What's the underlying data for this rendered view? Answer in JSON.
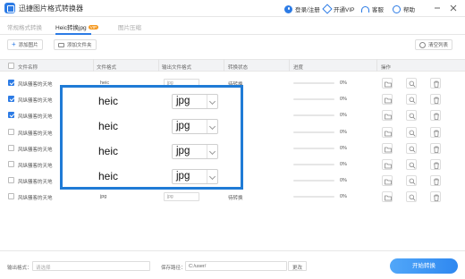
{
  "app": {
    "title": "迅捷图片格式转换器",
    "top_links": {
      "login": "登录/注册",
      "vip": "开通VIP",
      "service": "客服",
      "help": "帮助"
    }
  },
  "tabs": [
    {
      "label": "常规格式转换",
      "active": false
    },
    {
      "label": "Heic转换jpg",
      "badge": "VIP",
      "active": true
    },
    {
      "label": "图片压缩",
      "active": false
    }
  ],
  "toolbar": {
    "add_image": "添加图片",
    "add_folder": "添加文件夹",
    "clear_list": "清空列表"
  },
  "table": {
    "headers": [
      "文件名称",
      "文件格式",
      "输出文件格式",
      "转换状态",
      "进度",
      "操作"
    ],
    "rows": [
      {
        "name": "风纵骚客的天地",
        "format": "heic",
        "output": "jpg",
        "status": "待转换",
        "progress": "0%",
        "checked": true
      },
      {
        "name": "风纵骚客的天地",
        "format": "heic",
        "output": "jpg",
        "status": "待转换",
        "progress": "0%",
        "checked": true
      },
      {
        "name": "风纵骚客的天地",
        "format": "heic",
        "output": "jpg",
        "status": "待转换",
        "progress": "0%",
        "checked": true
      },
      {
        "name": "风纵骚客的天地",
        "format": "heic",
        "output": "jpg",
        "status": "待转换",
        "progress": "0%",
        "checked": false
      },
      {
        "name": "风纵骚客的天地",
        "format": "heic",
        "output": "jpg",
        "status": "待转换",
        "progress": "0%",
        "checked": false
      },
      {
        "name": "风纵骚客的天地",
        "format": "heic",
        "output": "jpg",
        "status": "待转换",
        "progress": "0%",
        "checked": false
      },
      {
        "name": "风纵骚客的天地",
        "format": "heic",
        "output": "jpg",
        "status": "待转换",
        "progress": "0%",
        "checked": false
      },
      {
        "name": "风纵骚客的天地",
        "format": "jpg",
        "output": "jpg",
        "status": "待转换",
        "progress": "0%",
        "checked": false
      }
    ]
  },
  "overlay": {
    "rows": [
      {
        "format": "heic",
        "output": "jpg"
      },
      {
        "format": "heic",
        "output": "jpg"
      },
      {
        "format": "heic",
        "output": "jpg"
      },
      {
        "format": "heic",
        "output": "jpg"
      }
    ]
  },
  "footer": {
    "output_format_label": "输出格式：",
    "output_format_placeholder": "请选择",
    "save_path_label": "保存路径：",
    "save_path_value": "C:/user/",
    "change_label": "更改",
    "start_label": "开始转换"
  },
  "colors": {
    "accent": "#2c7be5",
    "overlay_border": "#1f7bd6",
    "vip_badge": "#f59a23"
  }
}
